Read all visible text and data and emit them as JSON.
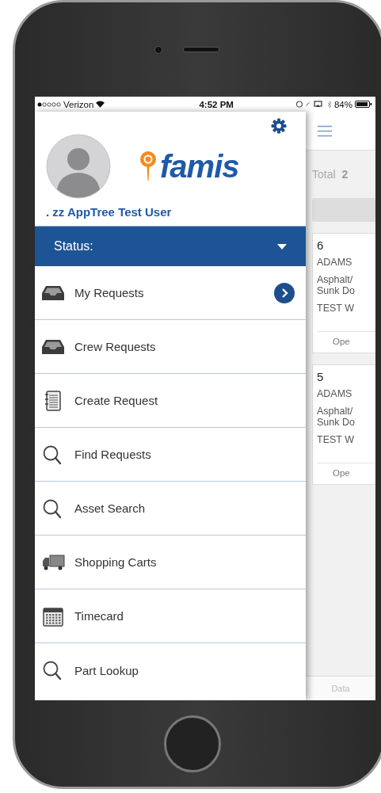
{
  "status_bar": {
    "carrier": "Verizon",
    "time": "4:52 PM",
    "battery": "84%"
  },
  "drawer": {
    "logo_text": "famis",
    "user_name": ". zz AppTree Test User",
    "status_label": "Status:",
    "menu": [
      {
        "label": "My Requests",
        "kind": "tray",
        "arrow": true
      },
      {
        "label": "Crew Requests",
        "kind": "tray",
        "arrow": false
      },
      {
        "label": "Create Request",
        "kind": "notepad",
        "arrow": false
      },
      {
        "label": "Find Requests",
        "kind": "search",
        "arrow": false
      },
      {
        "label": "Asset Search",
        "kind": "search",
        "arrow": false
      },
      {
        "label": "Shopping Carts",
        "kind": "truck",
        "arrow": false
      },
      {
        "label": "Timecard",
        "kind": "calendar",
        "arrow": false
      },
      {
        "label": "Part Lookup",
        "kind": "search",
        "arrow": false
      }
    ]
  },
  "main": {
    "total_label": "Total",
    "total_value": "2",
    "cards": [
      {
        "number": "6",
        "site": "ADAMS",
        "description": [
          "Asphalt/",
          "Sunk Do"
        ],
        "title": "TEST W",
        "status": "Ope"
      },
      {
        "number": "5",
        "site": "ADAMS",
        "description": [
          "Asphalt/",
          "Sunk Do"
        ],
        "title": "TEST W",
        "status": "Ope"
      }
    ],
    "footer": "Data"
  }
}
